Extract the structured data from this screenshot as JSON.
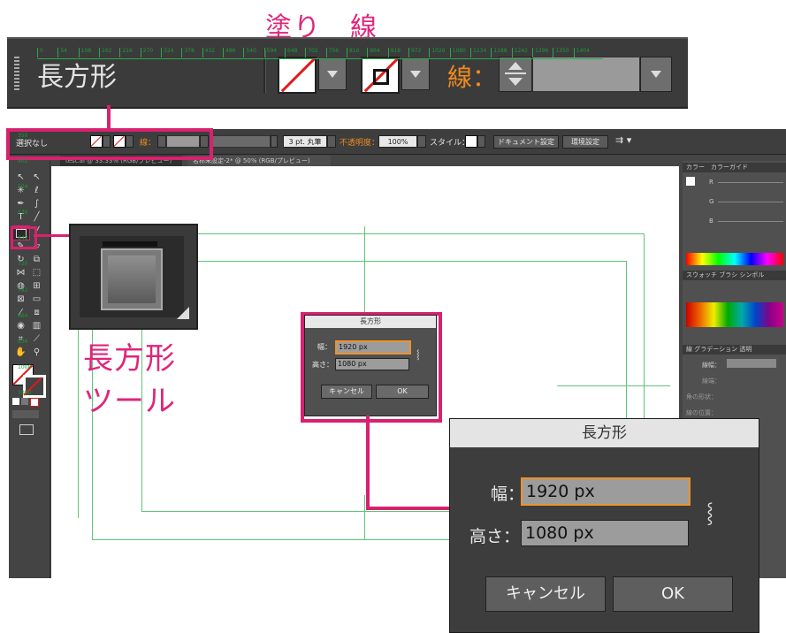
{
  "annotation": {
    "fill_stroke_title": "塗り　線",
    "tool_callout_line1": "長方形",
    "tool_callout_line2": "ツール"
  },
  "zoom_bar": {
    "label": "長方形",
    "stroke_label": "線："
  },
  "control_bar": {
    "selection": "選択なし",
    "stroke_label": "線：",
    "brush": "3 pt. 丸筆",
    "opacity_label": "不透明度：",
    "opacity_value": "100%",
    "style_label": "スタイル：",
    "doc_setup": "ドキュメント設定",
    "prefs": "環境設定"
  },
  "doc_tabs": [
    {
      "label": "test.ai @ 33.33% (RGB/プレビュー)",
      "active": false
    },
    {
      "label": "名称未設定-2* @ 50% (RGB/プレビュー)",
      "active": true
    }
  ],
  "ruler_h": [
    "0",
    "54",
    "108",
    "162",
    "216",
    "270",
    "324",
    "378",
    "432",
    "486",
    "540",
    "594",
    "648",
    "702",
    "756",
    "810",
    "864",
    "918",
    "972",
    "1026",
    "1080",
    "1134",
    "1188",
    "1242",
    "1296",
    "1350",
    "1404"
  ],
  "ruler_v": [
    "350",
    "402",
    "504",
    "576",
    "648",
    "720",
    "792",
    "864",
    "936",
    "1008",
    "1080"
  ],
  "right_panel": {
    "color_tab": "カラー",
    "color_guide_tab": "カラーガイド",
    "r": "R",
    "g": "G",
    "b": "B",
    "swatch_tab": "スウォッチ",
    "brush_tab": "ブラシ",
    "symbol_tab": "シンボル",
    "stroke_tab": "線",
    "gradient_tab": "グラデーション",
    "transparency_tab": "透明",
    "line_width": "線幅：",
    "line_pos": "線端：",
    "corner": "角の形状：",
    "align": "線の位置："
  },
  "dialog_small": {
    "title": "長方形",
    "width_label": "幅：",
    "width_value": "1920 px",
    "height_label": "高さ：",
    "height_value": "1080 px",
    "cancel": "キャンセル",
    "ok": "OK"
  },
  "dialog_big": {
    "title": "長方形",
    "width_label": "幅：",
    "width_value": "1920 px",
    "height_label": "高さ：",
    "height_value": "1080 px",
    "cancel": "キャンセル",
    "ok": "OK"
  },
  "colors": {
    "accent_magenta": "#d8216f",
    "stroke_orange": "#f08a1e",
    "guide_green": "#5fc47a",
    "ui_dark": "#3b3b3b"
  }
}
